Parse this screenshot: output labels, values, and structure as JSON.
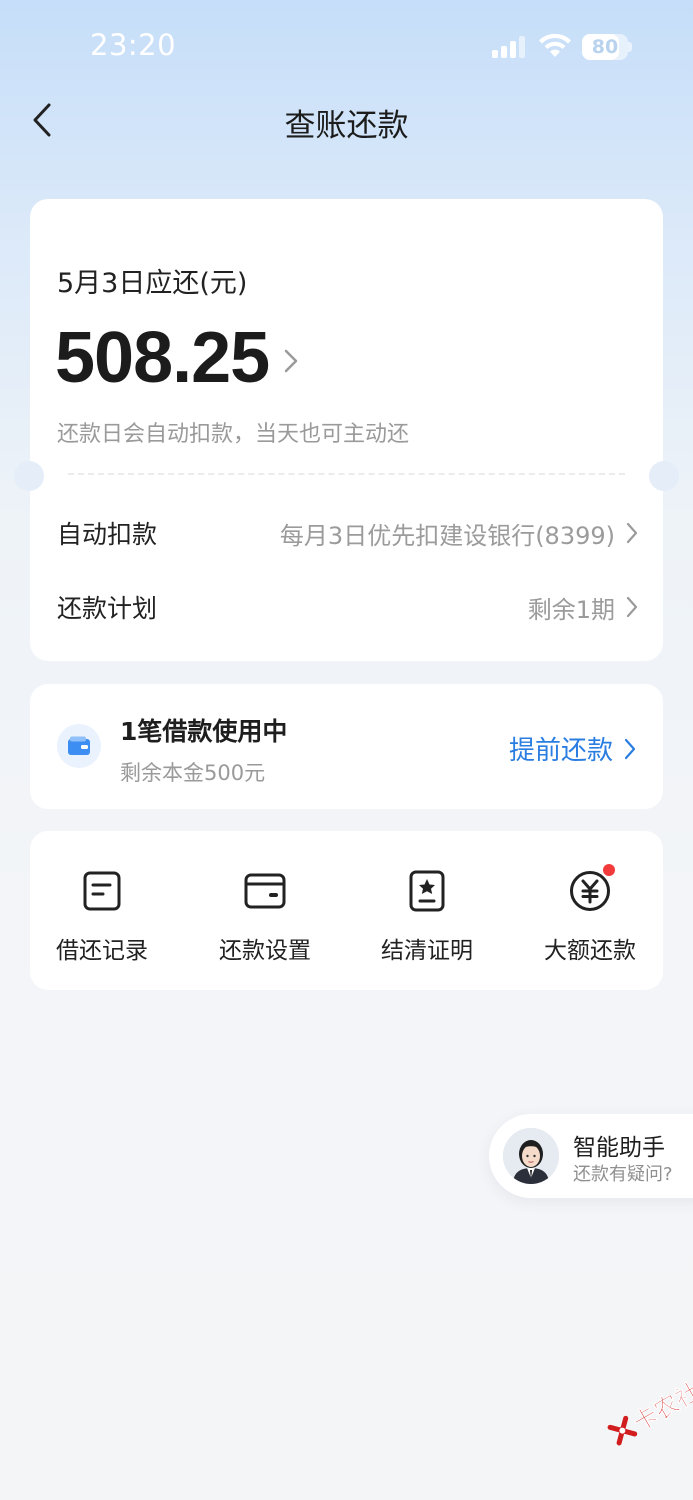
{
  "status_bar": {
    "time": "23:20",
    "battery_level": "80",
    "battery_fraction": 0.8
  },
  "header": {
    "title": "查账还款"
  },
  "due_card": {
    "title": "5月3日应还(元)",
    "amount": "508.25",
    "hint": "还款日会自动扣款，当天也可主动还",
    "rows": [
      {
        "label": "自动扣款",
        "value": "每月3日优先扣建设银行(8399)"
      },
      {
        "label": "还款计划",
        "value": "剩余1期"
      }
    ]
  },
  "loan_card": {
    "title": "1笔借款使用中",
    "subtitle": "剩余本金500元",
    "action": "提前还款"
  },
  "quick_actions": [
    {
      "label": "借还记录",
      "icon": "document-icon"
    },
    {
      "label": "还款设置",
      "icon": "card-icon"
    },
    {
      "label": "结清证明",
      "icon": "certificate-icon"
    },
    {
      "label": "大额还款",
      "icon": "yuan-icon",
      "badge": true
    }
  ],
  "assistant": {
    "name": "智能助手",
    "subtitle": "还款有疑问?"
  },
  "watermark": {
    "text": "卡农社区"
  },
  "colors": {
    "accent_blue": "#2a7de1",
    "badge_red": "#f43b3b",
    "watermark_red": "#d11d1d"
  }
}
